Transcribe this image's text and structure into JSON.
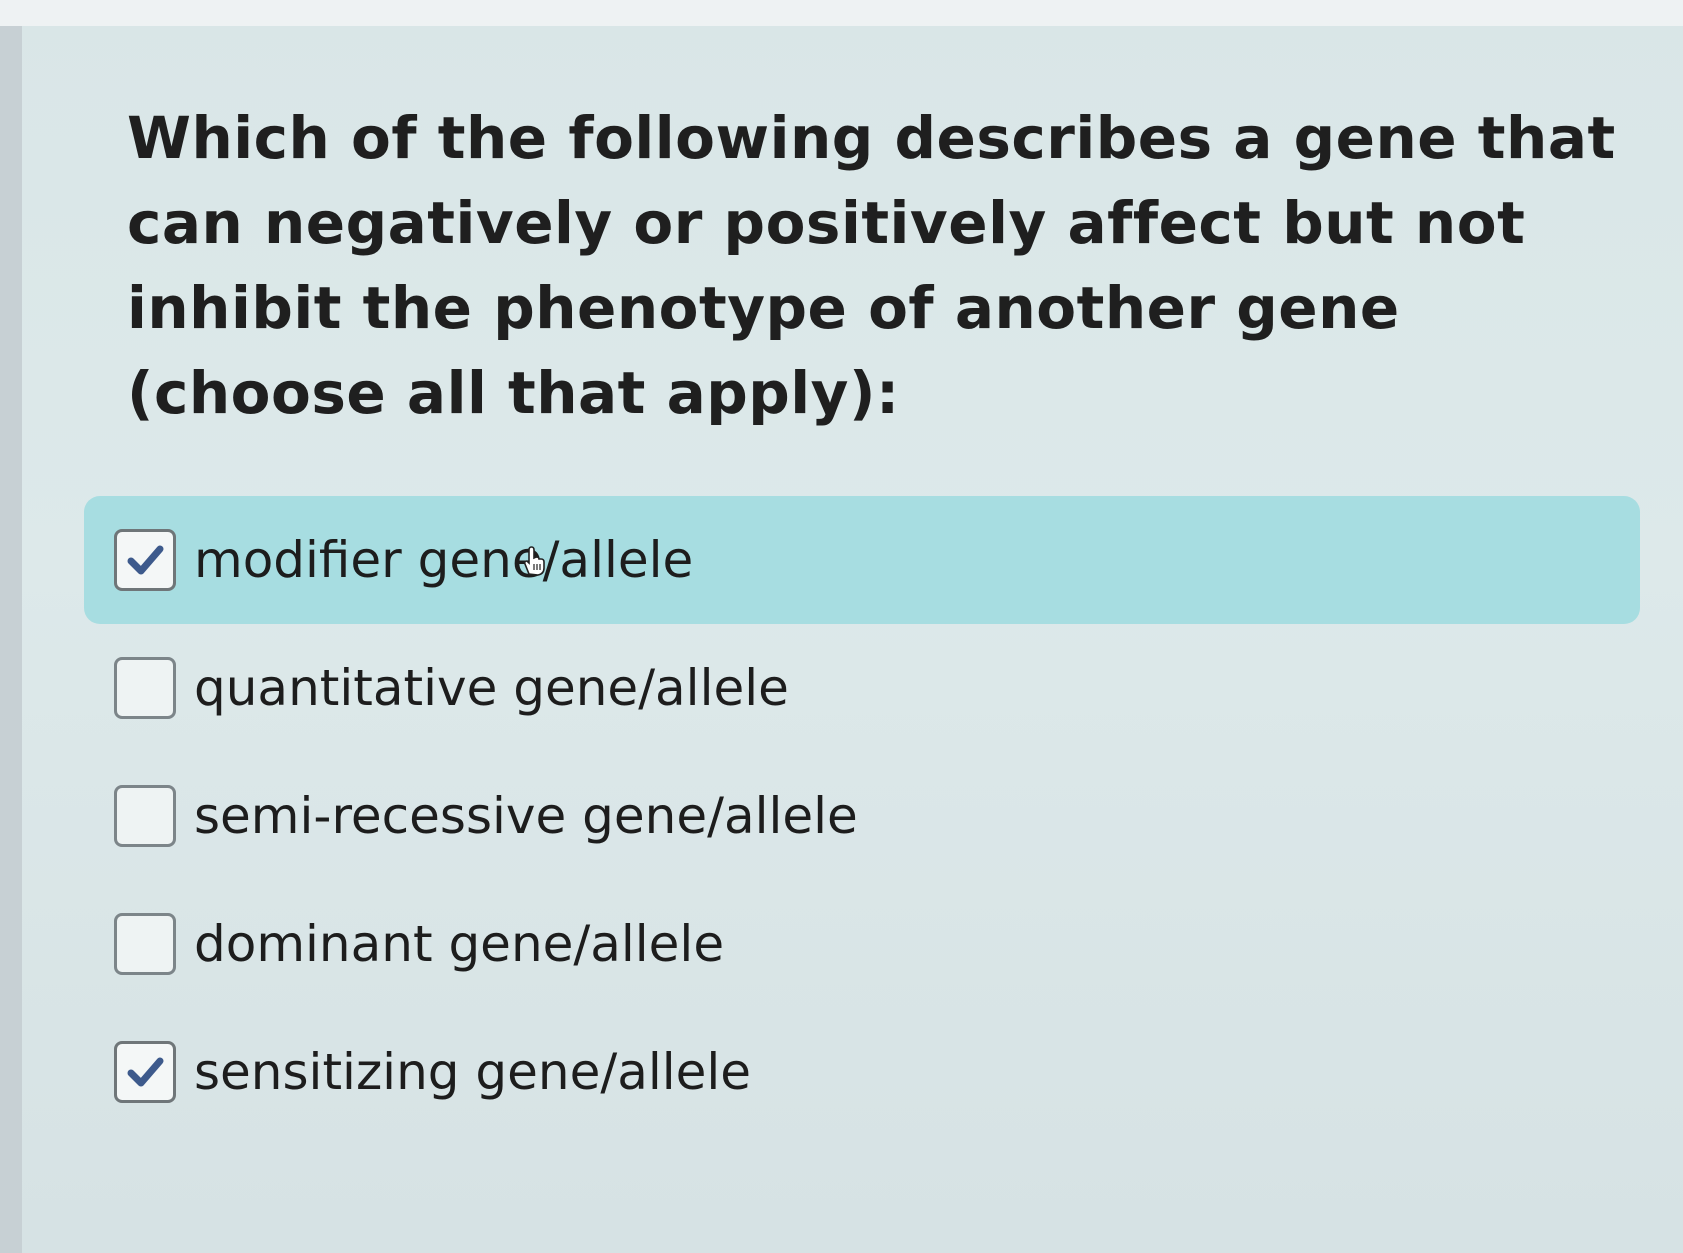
{
  "question": {
    "text": "Which of the following describes a gene that can negatively or positively affect but not inhibit the phenotype of another gene (choose all that apply):"
  },
  "options": [
    {
      "label": "modifier gene/allele",
      "checked": true,
      "highlighted": true
    },
    {
      "label": "quantitative gene/allele",
      "checked": false,
      "highlighted": false
    },
    {
      "label": "semi-recessive gene/allele",
      "checked": false,
      "highlighted": false
    },
    {
      "label": "dominant gene/allele",
      "checked": false,
      "highlighted": false
    },
    {
      "label": "sensitizing gene/allele",
      "checked": true,
      "highlighted": false
    }
  ],
  "colors": {
    "highlight": "#a7dde1",
    "check": "#3d5a8c",
    "background": "#dde9ea"
  },
  "icons": {
    "checkmark": "check-icon",
    "cursor": "hand-pointer-icon"
  }
}
